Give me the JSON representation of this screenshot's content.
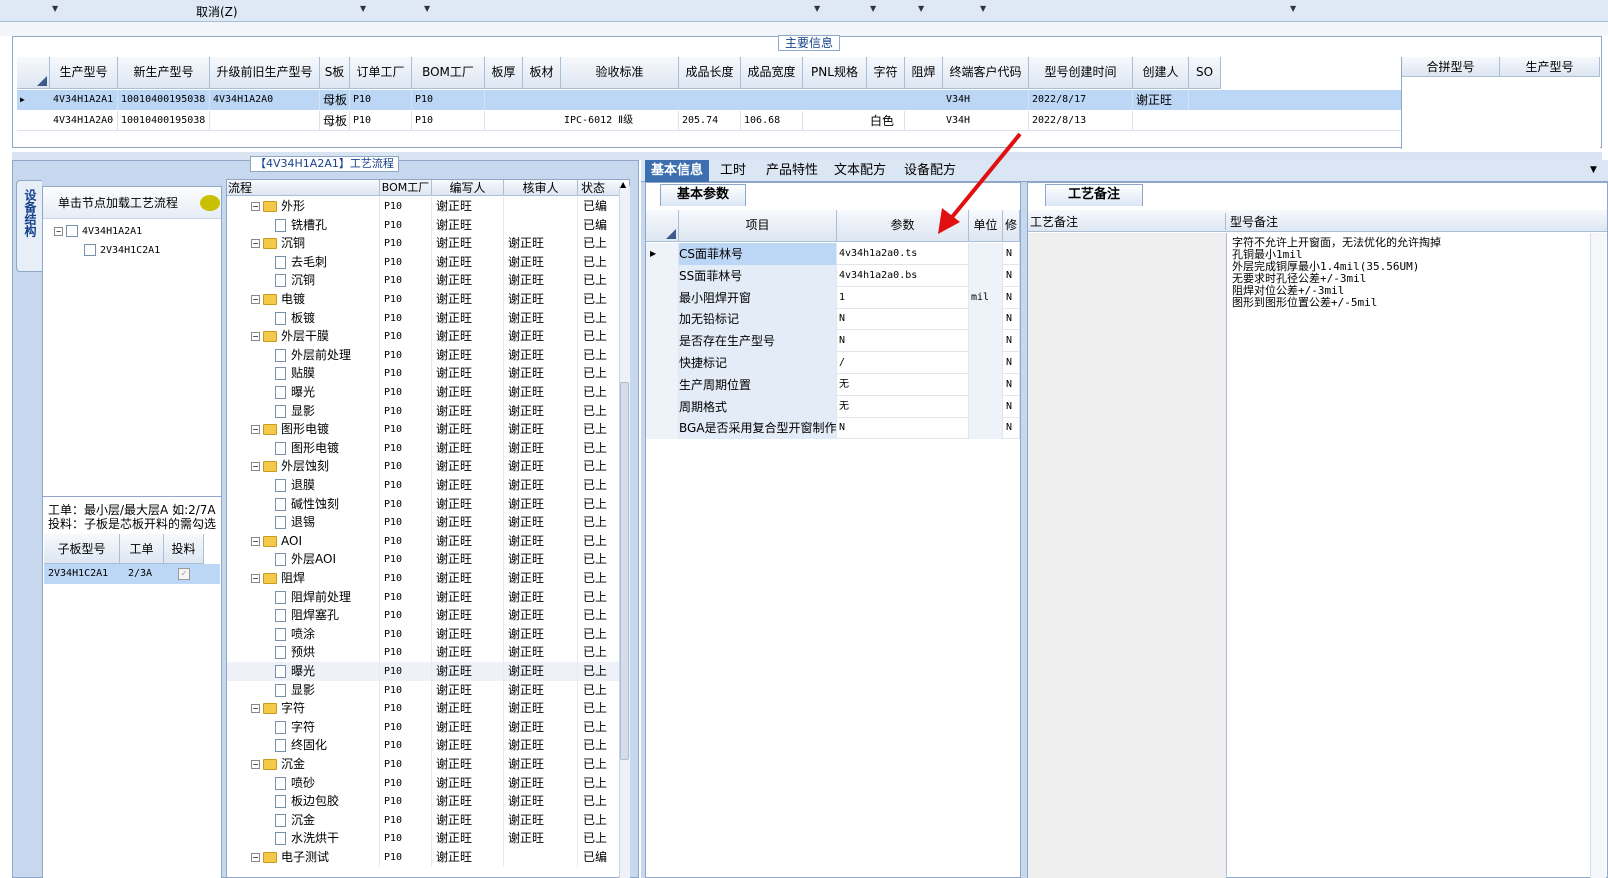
{
  "toolbar": {
    "cancel_label": "取消(Z)"
  },
  "main_info": {
    "legend": "主要信息",
    "columns": [
      "生产型号",
      "新生产型号",
      "升级前旧生产型号",
      "S板",
      "订单工厂",
      "BOM工厂",
      "板厚",
      "板材",
      "验收标准",
      "成品长度",
      "成品宽度",
      "PNL规格",
      "字符",
      "阻焊",
      "终端客户代码",
      "型号创建时间",
      "创建人",
      "SO"
    ],
    "rows": [
      [
        "4V34H1A2A1",
        "10010400195038",
        "4V34H1A2A0",
        "母板",
        "P10",
        "P10",
        "",
        "",
        "",
        "",
        "",
        "",
        "",
        "",
        "V34H",
        "2022/8/17",
        "谢正旺",
        ""
      ],
      [
        "4V34H1A2A0",
        "10010400195038",
        "",
        "母板",
        "P10",
        "P10",
        "",
        "",
        "IPC-6012 Ⅱ级",
        "205.74",
        "106.68",
        "",
        "白色",
        "",
        "V34H",
        "2022/8/13",
        "",
        ""
      ]
    ],
    "merge_columns": [
      "合拼型号",
      "生产型号"
    ]
  },
  "left": {
    "flow_legend": "【4V34H1A2A1】工艺流程",
    "vtab_label": "设备结构",
    "load_button": "单击节点加载工艺流程",
    "tree": [
      "4V34H1A2A1",
      "2V34H1C2A1"
    ],
    "info_line1": "工单：最小层/最大层A 如:2/7A",
    "info_line2": "投料：子板是芯板开料的需勾选",
    "sub_columns": [
      "子板型号",
      "工单",
      "投料"
    ],
    "sub_row": {
      "model": "2V34H1C2A1",
      "order": "2/3A"
    }
  },
  "flow": {
    "columns": [
      "流程",
      "BOM工厂",
      "编写人",
      "核审人",
      "状态"
    ],
    "rows": [
      {
        "type": "folder",
        "name": "外形",
        "f": "P10",
        "w": "谢正旺",
        "r": "",
        "s": "已编"
      },
      {
        "type": "doc",
        "name": "铣槽孔",
        "f": "P10",
        "w": "谢正旺",
        "r": "",
        "s": "已编"
      },
      {
        "type": "folder",
        "name": "沉铜",
        "f": "P10",
        "w": "谢正旺",
        "r": "谢正旺",
        "s": "已上"
      },
      {
        "type": "doc",
        "name": "去毛刺",
        "f": "P10",
        "w": "谢正旺",
        "r": "谢正旺",
        "s": "已上"
      },
      {
        "type": "doc",
        "name": "沉铜",
        "f": "P10",
        "w": "谢正旺",
        "r": "谢正旺",
        "s": "已上"
      },
      {
        "type": "folder",
        "name": "电镀",
        "f": "P10",
        "w": "谢正旺",
        "r": "谢正旺",
        "s": "已上"
      },
      {
        "type": "doc",
        "name": "板镀",
        "f": "P10",
        "w": "谢正旺",
        "r": "谢正旺",
        "s": "已上"
      },
      {
        "type": "folder",
        "name": "外层干膜",
        "f": "P10",
        "w": "谢正旺",
        "r": "谢正旺",
        "s": "已上"
      },
      {
        "type": "doc",
        "name": "外层前处理",
        "f": "P10",
        "w": "谢正旺",
        "r": "谢正旺",
        "s": "已上"
      },
      {
        "type": "doc",
        "name": "贴膜",
        "f": "P10",
        "w": "谢正旺",
        "r": "谢正旺",
        "s": "已上"
      },
      {
        "type": "doc",
        "name": "曝光",
        "f": "P10",
        "w": "谢正旺",
        "r": "谢正旺",
        "s": "已上"
      },
      {
        "type": "doc",
        "name": "显影",
        "f": "P10",
        "w": "谢正旺",
        "r": "谢正旺",
        "s": "已上"
      },
      {
        "type": "folder",
        "name": "图形电镀",
        "f": "P10",
        "w": "谢正旺",
        "r": "谢正旺",
        "s": "已上"
      },
      {
        "type": "doc",
        "name": "图形电镀",
        "f": "P10",
        "w": "谢正旺",
        "r": "谢正旺",
        "s": "已上"
      },
      {
        "type": "folder",
        "name": "外层蚀刻",
        "f": "P10",
        "w": "谢正旺",
        "r": "谢正旺",
        "s": "已上"
      },
      {
        "type": "doc",
        "name": "退膜",
        "f": "P10",
        "w": "谢正旺",
        "r": "谢正旺",
        "s": "已上"
      },
      {
        "type": "doc",
        "name": "碱性蚀刻",
        "f": "P10",
        "w": "谢正旺",
        "r": "谢正旺",
        "s": "已上"
      },
      {
        "type": "doc",
        "name": "退锡",
        "f": "P10",
        "w": "谢正旺",
        "r": "谢正旺",
        "s": "已上"
      },
      {
        "type": "folder",
        "name": "AOI",
        "f": "P10",
        "w": "谢正旺",
        "r": "谢正旺",
        "s": "已上"
      },
      {
        "type": "doc",
        "name": "外层AOI",
        "f": "P10",
        "w": "谢正旺",
        "r": "谢正旺",
        "s": "已上"
      },
      {
        "type": "folder",
        "name": "阻焊",
        "f": "P10",
        "w": "谢正旺",
        "r": "谢正旺",
        "s": "已上"
      },
      {
        "type": "doc",
        "name": "阻焊前处理",
        "f": "P10",
        "w": "谢正旺",
        "r": "谢正旺",
        "s": "已上"
      },
      {
        "type": "doc",
        "name": "阻焊塞孔",
        "f": "P10",
        "w": "谢正旺",
        "r": "谢正旺",
        "s": "已上"
      },
      {
        "type": "doc",
        "name": "喷涂",
        "f": "P10",
        "w": "谢正旺",
        "r": "谢正旺",
        "s": "已上"
      },
      {
        "type": "doc",
        "name": "预烘",
        "f": "P10",
        "w": "谢正旺",
        "r": "谢正旺",
        "s": "已上"
      },
      {
        "type": "doc",
        "name": "曝光",
        "f": "P10",
        "w": "谢正旺",
        "r": "谢正旺",
        "s": "已上"
      },
      {
        "type": "doc",
        "name": "显影",
        "f": "P10",
        "w": "谢正旺",
        "r": "谢正旺",
        "s": "已上"
      },
      {
        "type": "folder",
        "name": "字符",
        "f": "P10",
        "w": "谢正旺",
        "r": "谢正旺",
        "s": "已上"
      },
      {
        "type": "doc",
        "name": "字符",
        "f": "P10",
        "w": "谢正旺",
        "r": "谢正旺",
        "s": "已上"
      },
      {
        "type": "doc",
        "name": "终固化",
        "f": "P10",
        "w": "谢正旺",
        "r": "谢正旺",
        "s": "已上"
      },
      {
        "type": "folder",
        "name": "沉金",
        "f": "P10",
        "w": "谢正旺",
        "r": "谢正旺",
        "s": "已上"
      },
      {
        "type": "doc",
        "name": "喷砂",
        "f": "P10",
        "w": "谢正旺",
        "r": "谢正旺",
        "s": "已上"
      },
      {
        "type": "doc",
        "name": "板边包胶",
        "f": "P10",
        "w": "谢正旺",
        "r": "谢正旺",
        "s": "已上"
      },
      {
        "type": "doc",
        "name": "沉金",
        "f": "P10",
        "w": "谢正旺",
        "r": "谢正旺",
        "s": "已上"
      },
      {
        "type": "doc",
        "name": "水洗烘干",
        "f": "P10",
        "w": "谢正旺",
        "r": "谢正旺",
        "s": "已上"
      },
      {
        "type": "folder",
        "name": "电子测试",
        "f": "P10",
        "w": "谢正旺",
        "r": "",
        "s": "已编"
      }
    ]
  },
  "tabs": [
    "基本信息",
    "工时",
    "产品特性",
    "文本配方",
    "设备配方"
  ],
  "params": {
    "tab_label": "基本参数",
    "columns": [
      "项目",
      "参数",
      "单位",
      "修"
    ],
    "rows": [
      {
        "item": "CS面菲林号",
        "value": "4v34h1a2a0.ts",
        "unit": "",
        "flag": "N"
      },
      {
        "item": "SS面菲林号",
        "value": "4v34h1a2a0.bs",
        "unit": "",
        "flag": "N"
      },
      {
        "item": "最小阻焊开窗",
        "value": "1",
        "unit": "mil",
        "flag": "N"
      },
      {
        "item": "加无铅标记",
        "value": "N",
        "unit": "",
        "flag": "N"
      },
      {
        "item": "是否存在生产型号",
        "value": "N",
        "unit": "",
        "flag": "N"
      },
      {
        "item": "快捷标记",
        "value": "/",
        "unit": "",
        "flag": "N"
      },
      {
        "item": "生产周期位置",
        "value": "无",
        "unit": "",
        "flag": "N"
      },
      {
        "item": "周期格式",
        "value": "无",
        "unit": "",
        "flag": "N"
      },
      {
        "item": "BGA是否采用复合型开窗制作",
        "value": "N",
        "unit": "",
        "flag": "N"
      }
    ]
  },
  "notes": {
    "tab_label": "工艺备注",
    "col_process": "工艺备注",
    "col_model": "型号备注",
    "lines": [
      "字符不允许上开窗面，无法优化的允许掏掉",
      "孔铜最小1mil",
      "外层完成铜厚最小1.4mil(35.56UM)",
      "无要求时孔径公差+/-3mil",
      "阻焊对位公差+/-3mil",
      "图形到图形位置公差+/-5mil"
    ]
  },
  "colors": {
    "selected_row": "#bcd6f5",
    "active_tab": "#3d6fb0",
    "annotation_arrow": "#e01010"
  }
}
